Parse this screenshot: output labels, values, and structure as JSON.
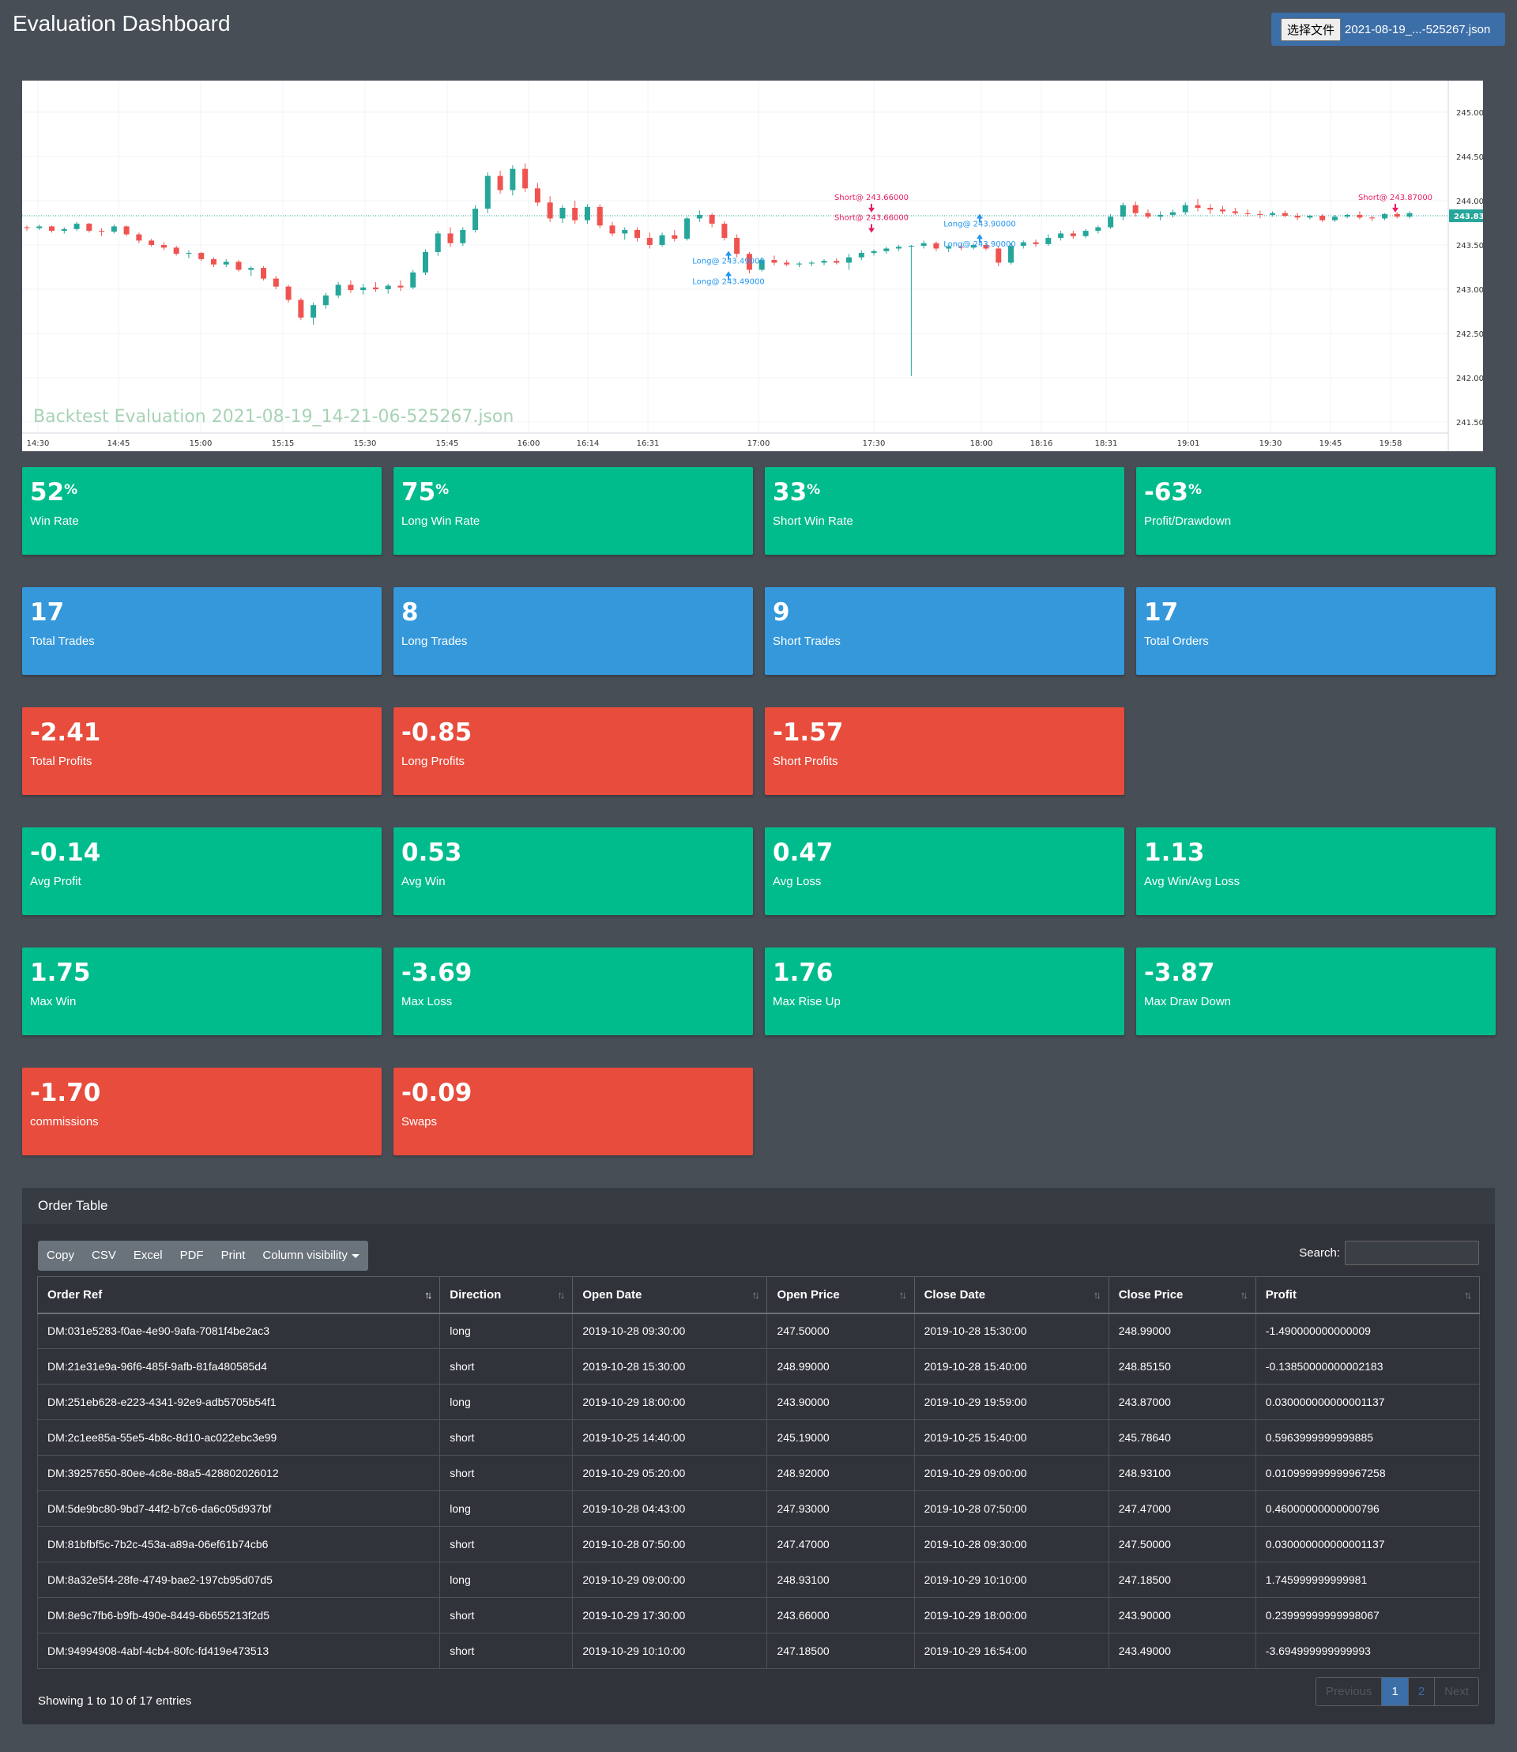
{
  "header": {
    "title": "Evaluation Dashboard",
    "file_button_label": "选择文件",
    "file_name": "2021-08-19_...-525267.json"
  },
  "chart_data": {
    "type": "candlestick",
    "watermark": "Backtest Evaluation 2021-08-19_14-21-06-525267.json",
    "y_ticks": [
      "245.00",
      "244.50",
      "244.00",
      "243.50",
      "243.00",
      "242.50",
      "242.00",
      "241.50"
    ],
    "x_ticks": [
      "14:30",
      "14:45",
      "15:00",
      "15:15",
      "15:30",
      "15:45",
      "16:00",
      "16:14",
      "16:31",
      "17:00",
      "17:30",
      "18:00",
      "18:16",
      "18:31",
      "19:01",
      "19:30",
      "19:45",
      "19:58"
    ],
    "last_price_label": "243.83",
    "last_price": 243.83,
    "ylim": [
      241.5,
      245.2
    ],
    "markers": [
      {
        "label": "Short@ 243.66000",
        "x": "17:30",
        "price": 243.66,
        "side": "short",
        "text_y": 244.01
      },
      {
        "label": "Short@ 243.66000",
        "x": "17:30",
        "price": 243.66,
        "side": "short",
        "text_y": 243.78
      },
      {
        "label": "Long@ 243.49000",
        "x": "16:51",
        "price": 243.49,
        "side": "long",
        "text_y": 243.29
      },
      {
        "label": "Long@ 243.49000",
        "x": "16:51",
        "price": 243.49,
        "side": "long",
        "text_y": 243.06
      },
      {
        "label": "Long@ 243.90000",
        "x": "18:00",
        "price": 243.9,
        "side": "long",
        "text_y": 243.71
      },
      {
        "label": "Long@ 243.90000",
        "x": "18:00",
        "price": 243.9,
        "side": "long",
        "text_y": 243.48
      },
      {
        "label": "Short@ 243.87000",
        "x": "19:58",
        "price": 243.87,
        "side": "short",
        "text_y": 244.01
      }
    ],
    "colors": {
      "up": "#26a69a",
      "down": "#ef5350",
      "long": "#2196f3",
      "short": "#e91e63"
    },
    "candles": [
      [
        243.7,
        243.72,
        243.66,
        243.69
      ],
      [
        243.69,
        243.73,
        243.67,
        243.71
      ],
      [
        243.71,
        243.72,
        243.64,
        243.66
      ],
      [
        243.66,
        243.7,
        243.63,
        243.68
      ],
      [
        243.68,
        243.76,
        243.66,
        243.74
      ],
      [
        243.74,
        243.75,
        243.64,
        243.66
      ],
      [
        243.66,
        243.69,
        243.6,
        243.65
      ],
      [
        243.65,
        243.73,
        243.63,
        243.71
      ],
      [
        243.71,
        243.72,
        243.6,
        243.62
      ],
      [
        243.62,
        243.64,
        243.52,
        243.55
      ],
      [
        243.55,
        243.57,
        243.48,
        243.5
      ],
      [
        243.5,
        243.53,
        243.44,
        243.47
      ],
      [
        243.47,
        243.49,
        243.38,
        243.4
      ],
      [
        243.4,
        243.44,
        243.35,
        243.41
      ],
      [
        243.41,
        243.42,
        243.32,
        243.34
      ],
      [
        243.34,
        243.36,
        243.25,
        243.28
      ],
      [
        243.28,
        243.34,
        243.25,
        243.31
      ],
      [
        243.31,
        243.33,
        243.2,
        243.22
      ],
      [
        243.22,
        243.26,
        243.15,
        243.24
      ],
      [
        243.24,
        243.26,
        243.1,
        243.12
      ],
      [
        243.12,
        243.15,
        243.0,
        243.03
      ],
      [
        243.03,
        243.05,
        242.85,
        242.88
      ],
      [
        242.88,
        242.9,
        242.65,
        242.68
      ],
      [
        242.68,
        242.85,
        242.6,
        242.82
      ],
      [
        242.82,
        242.96,
        242.78,
        242.93
      ],
      [
        242.93,
        243.08,
        242.9,
        243.05
      ],
      [
        243.05,
        243.1,
        242.96,
        242.99
      ],
      [
        242.99,
        243.06,
        242.94,
        243.02
      ],
      [
        243.02,
        243.08,
        242.97,
        243.0
      ],
      [
        243.0,
        243.06,
        242.95,
        243.04
      ],
      [
        243.04,
        243.1,
        242.98,
        243.02
      ],
      [
        243.02,
        243.22,
        243.0,
        243.19
      ],
      [
        243.19,
        243.45,
        243.16,
        243.42
      ],
      [
        243.42,
        243.66,
        243.38,
        243.63
      ],
      [
        243.63,
        243.7,
        243.48,
        243.52
      ],
      [
        243.52,
        243.7,
        243.49,
        243.67
      ],
      [
        243.67,
        243.95,
        243.64,
        243.91
      ],
      [
        243.91,
        244.32,
        243.86,
        244.28
      ],
      [
        244.28,
        244.34,
        244.08,
        244.12
      ],
      [
        244.12,
        244.4,
        244.06,
        244.36
      ],
      [
        244.36,
        244.42,
        244.1,
        244.14
      ],
      [
        244.14,
        244.2,
        243.94,
        243.98
      ],
      [
        243.98,
        244.05,
        243.76,
        243.8
      ],
      [
        243.8,
        243.95,
        243.75,
        243.92
      ],
      [
        243.92,
        244.0,
        243.74,
        243.78
      ],
      [
        243.78,
        243.96,
        243.74,
        243.93
      ],
      [
        243.93,
        243.96,
        243.69,
        243.72
      ],
      [
        243.72,
        243.76,
        243.6,
        243.63
      ],
      [
        243.63,
        243.7,
        243.56,
        243.67
      ],
      [
        243.67,
        243.7,
        243.54,
        243.58
      ],
      [
        243.58,
        243.64,
        243.46,
        243.5
      ],
      [
        243.5,
        243.64,
        243.48,
        243.61
      ],
      [
        243.61,
        243.67,
        243.54,
        243.57
      ],
      [
        243.57,
        243.82,
        243.55,
        243.8
      ],
      [
        243.8,
        243.89,
        243.76,
        243.84
      ],
      [
        243.84,
        243.86,
        243.7,
        243.74
      ],
      [
        243.74,
        243.77,
        243.55,
        243.58
      ],
      [
        243.58,
        243.62,
        243.36,
        243.4
      ],
      [
        243.4,
        243.42,
        243.18,
        243.22
      ],
      [
        243.22,
        243.36,
        243.2,
        243.33
      ],
      [
        243.33,
        243.38,
        243.27,
        243.3
      ],
      [
        243.3,
        243.33,
        243.26,
        243.28
      ],
      [
        243.28,
        243.31,
        243.25,
        243.29
      ],
      [
        243.29,
        243.32,
        243.26,
        243.3
      ],
      [
        243.3,
        243.34,
        243.27,
        243.32
      ],
      [
        243.32,
        243.35,
        243.28,
        243.3
      ],
      [
        243.3,
        243.4,
        243.22,
        243.36
      ],
      [
        243.36,
        243.44,
        243.33,
        243.41
      ],
      [
        243.41,
        243.45,
        243.38,
        243.43
      ],
      [
        243.43,
        243.48,
        243.4,
        243.46
      ],
      [
        243.46,
        243.5,
        243.43,
        243.48
      ],
      [
        243.48,
        243.5,
        242.02,
        243.49
      ],
      [
        243.49,
        243.55,
        243.46,
        243.52
      ],
      [
        243.52,
        243.54,
        243.43,
        243.46
      ],
      [
        243.46,
        243.5,
        243.42,
        243.48
      ],
      [
        243.48,
        243.51,
        243.44,
        243.47
      ],
      [
        243.47,
        243.52,
        243.45,
        243.5
      ],
      [
        243.5,
        243.52,
        243.44,
        243.46
      ],
      [
        243.46,
        243.48,
        243.26,
        243.3
      ],
      [
        243.3,
        243.52,
        243.28,
        243.49
      ],
      [
        243.49,
        243.55,
        243.46,
        243.53
      ],
      [
        243.53,
        243.56,
        243.48,
        243.51
      ],
      [
        243.51,
        243.62,
        243.49,
        243.58
      ],
      [
        243.58,
        243.66,
        243.55,
        243.63
      ],
      [
        243.63,
        243.66,
        243.57,
        243.6
      ],
      [
        243.6,
        243.68,
        243.58,
        243.66
      ],
      [
        243.66,
        243.72,
        243.63,
        243.7
      ],
      [
        243.7,
        243.85,
        243.68,
        243.82
      ],
      [
        243.82,
        243.98,
        243.78,
        243.95
      ],
      [
        243.95,
        243.99,
        243.82,
        243.86
      ],
      [
        243.86,
        243.9,
        243.8,
        243.82
      ],
      [
        243.82,
        243.88,
        243.78,
        243.84
      ],
      [
        243.84,
        243.9,
        243.81,
        243.87
      ],
      [
        243.87,
        243.98,
        243.84,
        243.95
      ],
      [
        243.95,
        244.02,
        243.88,
        243.92
      ],
      [
        243.92,
        243.96,
        243.85,
        243.9
      ],
      [
        243.9,
        243.94,
        243.85,
        243.88
      ],
      [
        243.88,
        243.92,
        243.84,
        243.86
      ],
      [
        243.86,
        243.9,
        243.82,
        243.85
      ],
      [
        243.85,
        243.89,
        243.8,
        243.84
      ],
      [
        243.84,
        243.88,
        243.82,
        243.86
      ],
      [
        243.86,
        243.89,
        243.81,
        243.83
      ],
      [
        243.83,
        243.86,
        243.78,
        243.81
      ],
      [
        243.81,
        243.84,
        243.79,
        243.83
      ],
      [
        243.83,
        243.85,
        243.76,
        243.78
      ],
      [
        243.78,
        243.84,
        243.76,
        243.82
      ],
      [
        243.82,
        243.85,
        243.8,
        243.84
      ],
      [
        243.84,
        243.88,
        243.79,
        243.81
      ],
      [
        243.81,
        243.83,
        243.77,
        243.8
      ],
      [
        243.8,
        243.86,
        243.78,
        243.85
      ],
      [
        243.85,
        243.87,
        243.8,
        243.82
      ],
      [
        243.82,
        243.88,
        243.8,
        243.86
      ]
    ]
  },
  "stats": [
    {
      "value": "52",
      "unit": "%",
      "label": "Win Rate",
      "color": "green"
    },
    {
      "value": "75",
      "unit": "%",
      "label": "Long Win Rate",
      "color": "green"
    },
    {
      "value": "33",
      "unit": "%",
      "label": "Short Win Rate",
      "color": "green"
    },
    {
      "value": "-63",
      "unit": "%",
      "label": "Profit/Drawdown",
      "color": "green"
    },
    {
      "value": "17",
      "unit": "",
      "label": "Total Trades",
      "color": "blue"
    },
    {
      "value": "8",
      "unit": "",
      "label": "Long Trades",
      "color": "blue"
    },
    {
      "value": "9",
      "unit": "",
      "label": "Short Trades",
      "color": "blue"
    },
    {
      "value": "17",
      "unit": "",
      "label": "Total Orders",
      "color": "blue"
    },
    {
      "value": "-2.41",
      "unit": "",
      "label": "Total Profits",
      "color": "red"
    },
    {
      "value": "-0.85",
      "unit": "",
      "label": "Long Profits",
      "color": "red"
    },
    {
      "value": "-1.57",
      "unit": "",
      "label": "Short Profits",
      "color": "red"
    },
    {
      "value": "-0.14",
      "unit": "",
      "label": "Avg Profit",
      "color": "green"
    },
    {
      "value": "0.53",
      "unit": "",
      "label": "Avg Win",
      "color": "green"
    },
    {
      "value": "0.47",
      "unit": "",
      "label": "Avg Loss",
      "color": "green"
    },
    {
      "value": "1.13",
      "unit": "",
      "label": "Avg Win/Avg Loss",
      "color": "green"
    },
    {
      "value": "1.75",
      "unit": "",
      "label": "Max Win",
      "color": "green"
    },
    {
      "value": "-3.69",
      "unit": "",
      "label": "Max Loss",
      "color": "green"
    },
    {
      "value": "1.76",
      "unit": "",
      "label": "Max Rise Up",
      "color": "green"
    },
    {
      "value": "-3.87",
      "unit": "",
      "label": "Max Draw Down",
      "color": "green"
    },
    {
      "value": "-1.70",
      "unit": "",
      "label": "commissions",
      "color": "red"
    },
    {
      "value": "-0.09",
      "unit": "",
      "label": "Swaps",
      "color": "red"
    }
  ],
  "order_table": {
    "title": "Order Table",
    "buttons": [
      "Copy",
      "CSV",
      "Excel",
      "PDF",
      "Print",
      "Column visibility"
    ],
    "search_label": "Search:",
    "search_value": "",
    "columns": [
      "Order Ref",
      "Direction",
      "Open Date",
      "Open Price",
      "Close Date",
      "Close Price",
      "Profit"
    ],
    "rows": [
      [
        "DM:031e5283-f0ae-4e90-9afa-7081f4be2ac3",
        "long",
        "2019-10-28 09:30:00",
        "247.50000",
        "2019-10-28 15:30:00",
        "248.99000",
        "-1.490000000000009"
      ],
      [
        "DM:21e31e9a-96f6-485f-9afb-81fa480585d4",
        "short",
        "2019-10-28 15:30:00",
        "248.99000",
        "2019-10-28 15:40:00",
        "248.85150",
        "-0.13850000000002183"
      ],
      [
        "DM:251eb628-e223-4341-92e9-adb5705b54f1",
        "long",
        "2019-10-29 18:00:00",
        "243.90000",
        "2019-10-29 19:59:00",
        "243.87000",
        "0.030000000000001137"
      ],
      [
        "DM:2c1ee85a-55e5-4b8c-8d10-ac022ebc3e99",
        "short",
        "2019-10-25 14:40:00",
        "245.19000",
        "2019-10-25 15:40:00",
        "245.78640",
        "0.5963999999999885"
      ],
      [
        "DM:39257650-80ee-4c8e-88a5-428802026012",
        "short",
        "2019-10-29 05:20:00",
        "248.92000",
        "2019-10-29 09:00:00",
        "248.93100",
        "0.010999999999967258"
      ],
      [
        "DM:5de9bc80-9bd7-44f2-b7c6-da6c05d937bf",
        "long",
        "2019-10-28 04:43:00",
        "247.93000",
        "2019-10-28 07:50:00",
        "247.47000",
        "0.46000000000000796"
      ],
      [
        "DM:81bfbf5c-7b2c-453a-a89a-06ef61b74cb6",
        "short",
        "2019-10-28 07:50:00",
        "247.47000",
        "2019-10-28 09:30:00",
        "247.50000",
        "0.030000000000001137"
      ],
      [
        "DM:8a32e5f4-28fe-4749-bae2-197cb95d07d5",
        "long",
        "2019-10-29 09:00:00",
        "248.93100",
        "2019-10-29 10:10:00",
        "247.18500",
        "1.745999999999981"
      ],
      [
        "DM:8e9c7fb6-b9fb-490e-8449-6b655213f2d5",
        "short",
        "2019-10-29 17:30:00",
        "243.66000",
        "2019-10-29 18:00:00",
        "243.90000",
        "0.23999999999998067"
      ],
      [
        "DM:94994908-4abf-4cb4-80fc-fd419e473513",
        "short",
        "2019-10-29 10:10:00",
        "247.18500",
        "2019-10-29 16:54:00",
        "243.49000",
        "-3.694999999999993"
      ]
    ],
    "info": "Showing 1 to 10 of 17 entries",
    "pagination": {
      "previous": "Previous",
      "pages": [
        "1",
        "2"
      ],
      "active": "1",
      "next": "Next"
    }
  }
}
